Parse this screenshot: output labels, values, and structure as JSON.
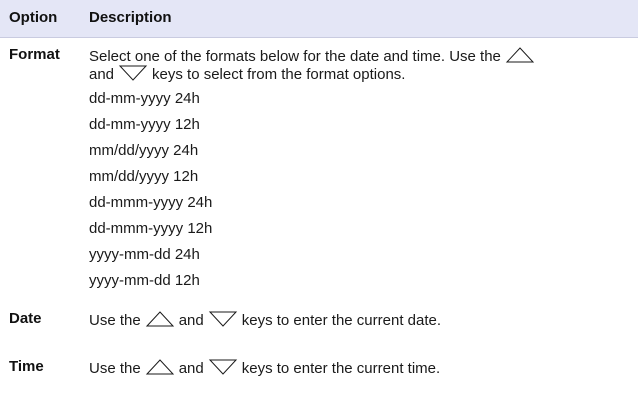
{
  "header": {
    "option": "Option",
    "description": "Description"
  },
  "rows": [
    {
      "term": "Format",
      "line1_before": "Select one of the formats below for the date and time. Use the",
      "line2_before": "and",
      "line2_after": "keys to select from the format options.",
      "formats": [
        "dd-mm-yyyy 24h",
        "dd-mm-yyyy 12h",
        "mm/dd/yyyy 24h",
        "mm/dd/yyyy 12h",
        "dd-mmm-yyyy 24h",
        "dd-mmm-yyyy 12h",
        "yyyy-mm-dd 24h",
        "yyyy-mm-dd 12h"
      ]
    },
    {
      "term": "Date",
      "before": "Use the",
      "mid": "and",
      "after": "keys to enter the current date."
    },
    {
      "term": "Time",
      "before": "Use the",
      "mid": "and",
      "after": "keys to enter the current time."
    }
  ],
  "icons": {
    "up": "up-arrow-key-icon",
    "down": "down-arrow-key-icon"
  },
  "colors": {
    "header_bg": "#e4e6f6",
    "text": "#1a1a1a"
  }
}
